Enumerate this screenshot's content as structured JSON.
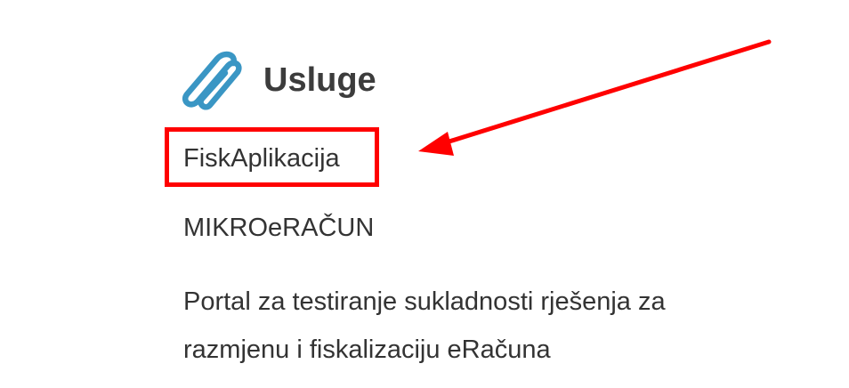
{
  "services": {
    "title": "Usluge",
    "icon": "paperclip-icon",
    "icon_color": "#3a96c4",
    "links": [
      {
        "label": "FiskAplikacija"
      },
      {
        "label": "MIKROeRAČUN"
      },
      {
        "label": "Portal za testiranje sukladnosti rješenja za razmjenu i fiskalizaciju eRačuna"
      }
    ]
  },
  "annotation": {
    "highlight_color": "#ff0000",
    "highlighted_item": "FiskAplikacija"
  }
}
